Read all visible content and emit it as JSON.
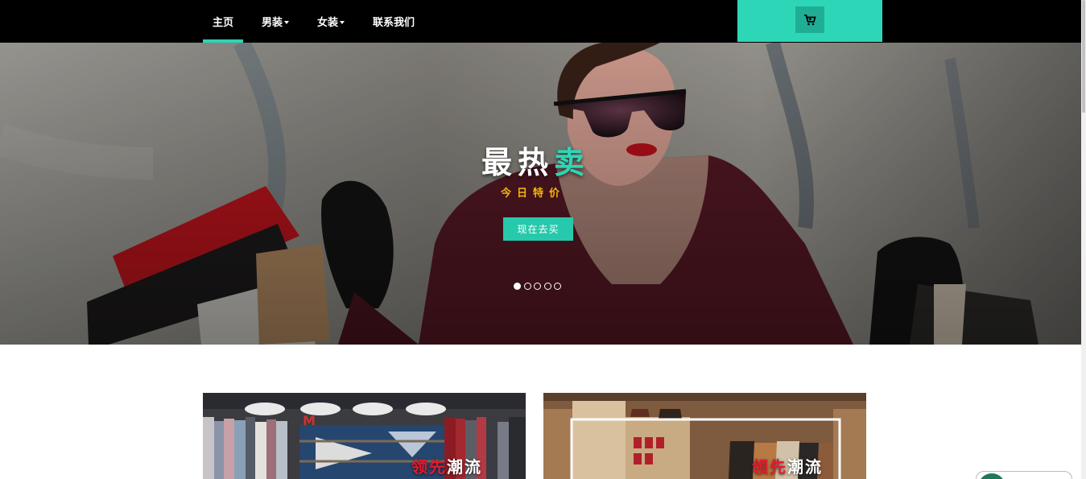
{
  "nav": {
    "items": [
      {
        "label": "主页",
        "active": true,
        "dropdown": false
      },
      {
        "label": "男装",
        "active": false,
        "dropdown": true
      },
      {
        "label": "女装",
        "active": false,
        "dropdown": true
      },
      {
        "label": "联系我们",
        "active": false,
        "dropdown": false
      }
    ],
    "cart_icon": "shopping-cart-icon"
  },
  "hero": {
    "title_main": "最热",
    "title_accent": "卖",
    "subtitle": "今日特价",
    "cta_label": "现在去买",
    "slides_total": 5,
    "active_slide": 1
  },
  "cards": [
    {
      "label_red": "领先",
      "label_white": "潮流"
    },
    {
      "label_red": "领先",
      "label_white": "潮流"
    }
  ],
  "colors": {
    "accent": "#2dd6b6",
    "nav_bg": "#000000",
    "subtitle": "#f5b60a",
    "label_red": "#e8192c"
  }
}
